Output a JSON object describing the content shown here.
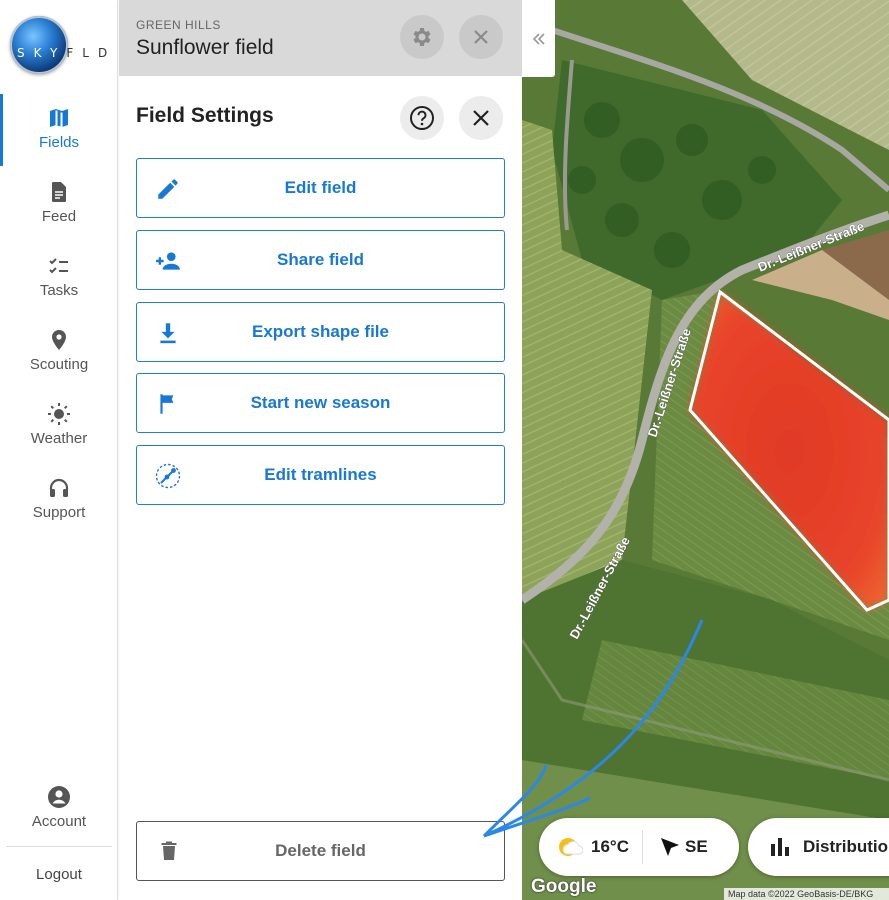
{
  "brand": {
    "logo_text_highlight": "SKY",
    "logo_text_rest": "FLD"
  },
  "nav": {
    "items": [
      {
        "label": "Fields",
        "icon": "map-icon",
        "active": true
      },
      {
        "label": "Feed",
        "icon": "feed-icon"
      },
      {
        "label": "Tasks",
        "icon": "tasks-icon"
      },
      {
        "label": "Scouting",
        "icon": "pin-icon"
      },
      {
        "label": "Weather",
        "icon": "sun-icon"
      },
      {
        "label": "Support",
        "icon": "headset-icon"
      }
    ],
    "account_label": "Account",
    "logout_label": "Logout"
  },
  "panel": {
    "farm_name": "GREEN HILLS",
    "field_name": "Sunflower field",
    "settings_title": "Field Settings",
    "actions": [
      {
        "label": "Edit field",
        "icon": "pencil-icon"
      },
      {
        "label": "Share field",
        "icon": "add-person-icon"
      },
      {
        "label": "Export shape file",
        "icon": "download-icon"
      },
      {
        "label": "Start new season",
        "icon": "flag-icon"
      },
      {
        "label": "Edit tramlines",
        "icon": "tramline-icon"
      }
    ],
    "delete_label": "Delete field"
  },
  "map": {
    "street_labels": [
      "Dr.-Leißner-Straße",
      "Dr.-Leißner-Straße",
      "Dr.-Leißner-Straße"
    ],
    "weather": {
      "temperature": "16°C",
      "wind_direction": "SE"
    },
    "distribution_label": "Distributio",
    "google_label": "Google",
    "attribution": "Map data ©2022 GeoBasis-DE/BKG",
    "colors": {
      "field_heat": "#e8442a",
      "annotation_arrow": "#2a88e8",
      "accent": "#1878d8"
    }
  }
}
